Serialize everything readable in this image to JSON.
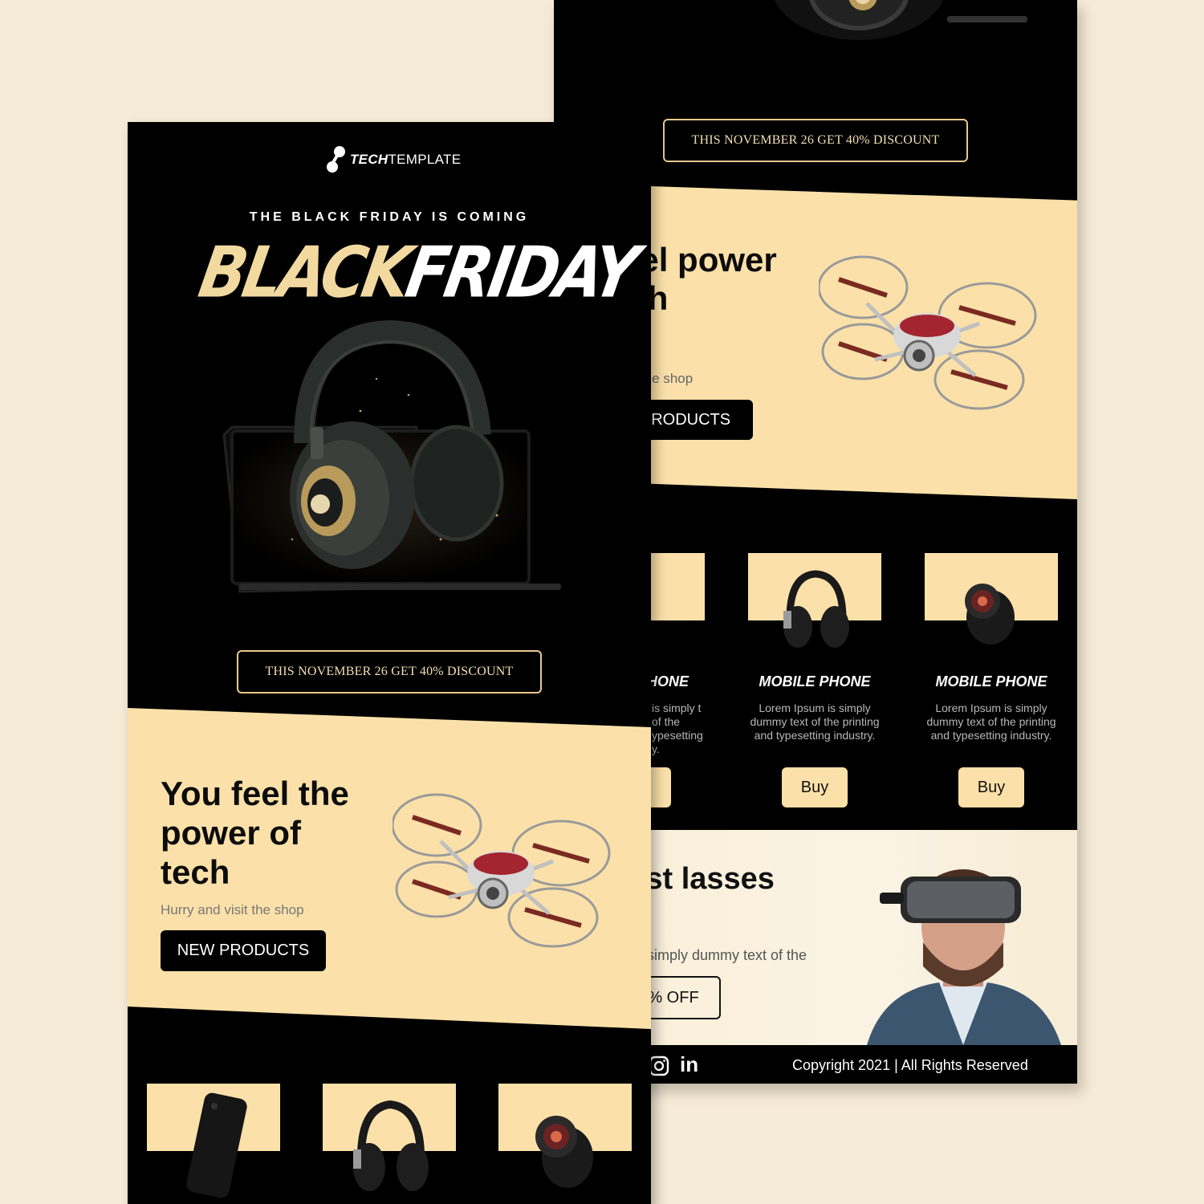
{
  "brand": {
    "logo_bold": "TECH",
    "logo_light": "TEMPLATE"
  },
  "header": {
    "eyebrow": "THE BLACK FRIDAY IS COMING",
    "headline_part1": "BLACK",
    "headline_part2": "FRIDAY"
  },
  "discount": {
    "label": "THIS NOVEMBER 26 GET 40% DISCOUNT"
  },
  "hero": {
    "title": "You feel the power of tech",
    "subtitle": "Hurry and visit the shop",
    "button": "NEW PRODUCTS",
    "back_title": "feel power ech",
    "back_subtitle": "visit the shop",
    "back_button": "PRODUCTS"
  },
  "products": [
    {
      "title": "HONE",
      "desc": "is simply t of the ypesetting y.",
      "button": ""
    },
    {
      "title": "MOBILE PHONE",
      "desc": "Lorem Ipsum is simply dummy text of the printing and typesetting industry.",
      "button": "Buy"
    },
    {
      "title": "MOBILE PHONE",
      "desc": "Lorem Ipsum is simply dummy text of the printing and typesetting industry.",
      "button": "Buy"
    }
  ],
  "vr": {
    "title": "best lasses",
    "text": "m is simply dummy text of the",
    "button": "% OFF"
  },
  "footer": {
    "copyright": "Copyright 2021 | All Rights Reserved",
    "social_linkedin": "in"
  },
  "colors": {
    "accent": "#fbe1a9",
    "background": "#f6ebd6",
    "dark": "#000000",
    "gold": "#e8c98d"
  },
  "icons": [
    "techtemplate-logo-icon",
    "instagram-icon",
    "linkedin-icon"
  ]
}
